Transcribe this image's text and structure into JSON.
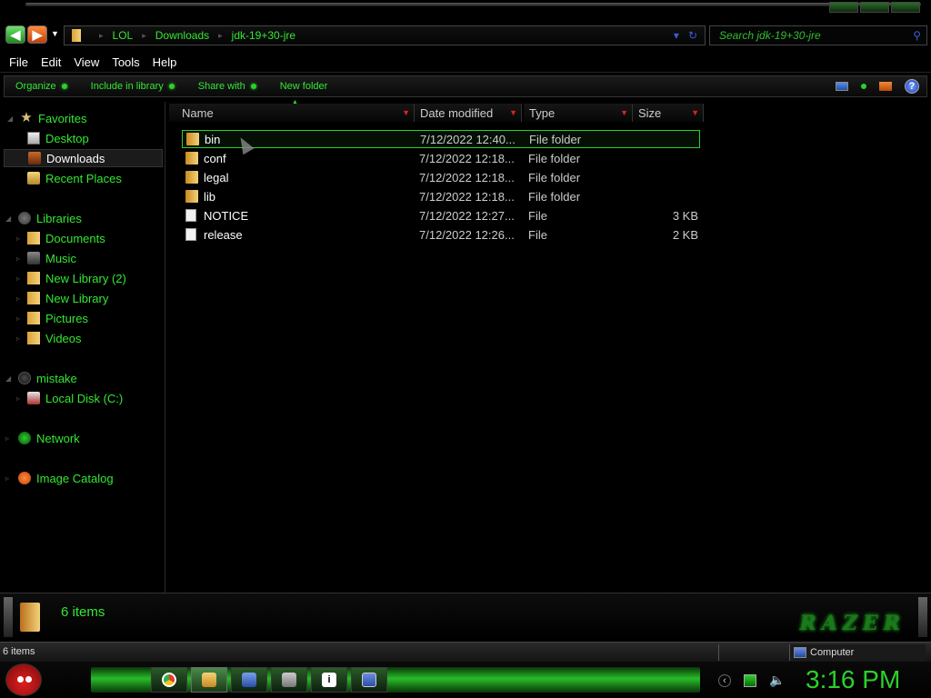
{
  "address": {
    "crumbs": [
      "LOL",
      "Downloads",
      "jdk-19+30-jre"
    ]
  },
  "search": {
    "placeholder": "Search jdk-19+30-jre"
  },
  "menu": [
    "File",
    "Edit",
    "View",
    "Tools",
    "Help"
  ],
  "commands": {
    "organize": "Organize",
    "include_library": "Include in library",
    "share_with": "Share with",
    "new_folder": "New folder"
  },
  "nav": {
    "favorites": "Favorites",
    "desktop": "Desktop",
    "downloads": "Downloads",
    "recent_places": "Recent Places",
    "libraries": "Libraries",
    "documents": "Documents",
    "music": "Music",
    "new_library_2": "New Library (2)",
    "new_library": "New Library",
    "pictures": "Pictures",
    "videos": "Videos",
    "mistake": "mistake",
    "local_disk": "Local Disk (C:)",
    "network": "Network",
    "image_catalog": "Image Catalog"
  },
  "columns": {
    "name": "Name",
    "date": "Date modified",
    "type": "Type",
    "size": "Size"
  },
  "files": [
    {
      "name": "bin",
      "date": "7/12/2022 12:40...",
      "type": "File folder",
      "size": "",
      "kind": "folder"
    },
    {
      "name": "conf",
      "date": "7/12/2022 12:18...",
      "type": "File folder",
      "size": "",
      "kind": "folder"
    },
    {
      "name": "legal",
      "date": "7/12/2022 12:18...",
      "type": "File folder",
      "size": "",
      "kind": "folder"
    },
    {
      "name": "lib",
      "date": "7/12/2022 12:18...",
      "type": "File folder",
      "size": "",
      "kind": "folder"
    },
    {
      "name": "NOTICE",
      "date": "7/12/2022 12:27...",
      "type": "File",
      "size": "3 KB",
      "kind": "file"
    },
    {
      "name": "release",
      "date": "7/12/2022 12:26...",
      "type": "File",
      "size": "2 KB",
      "kind": "file"
    }
  ],
  "details": {
    "count": "6 items",
    "brand": "RAZER"
  },
  "status": {
    "items": "6 items",
    "zone": "Computer"
  },
  "clock": "3:16 PM",
  "colors": {
    "accent": "#33e833",
    "selection": "#2bd12b",
    "background": "#000000"
  }
}
